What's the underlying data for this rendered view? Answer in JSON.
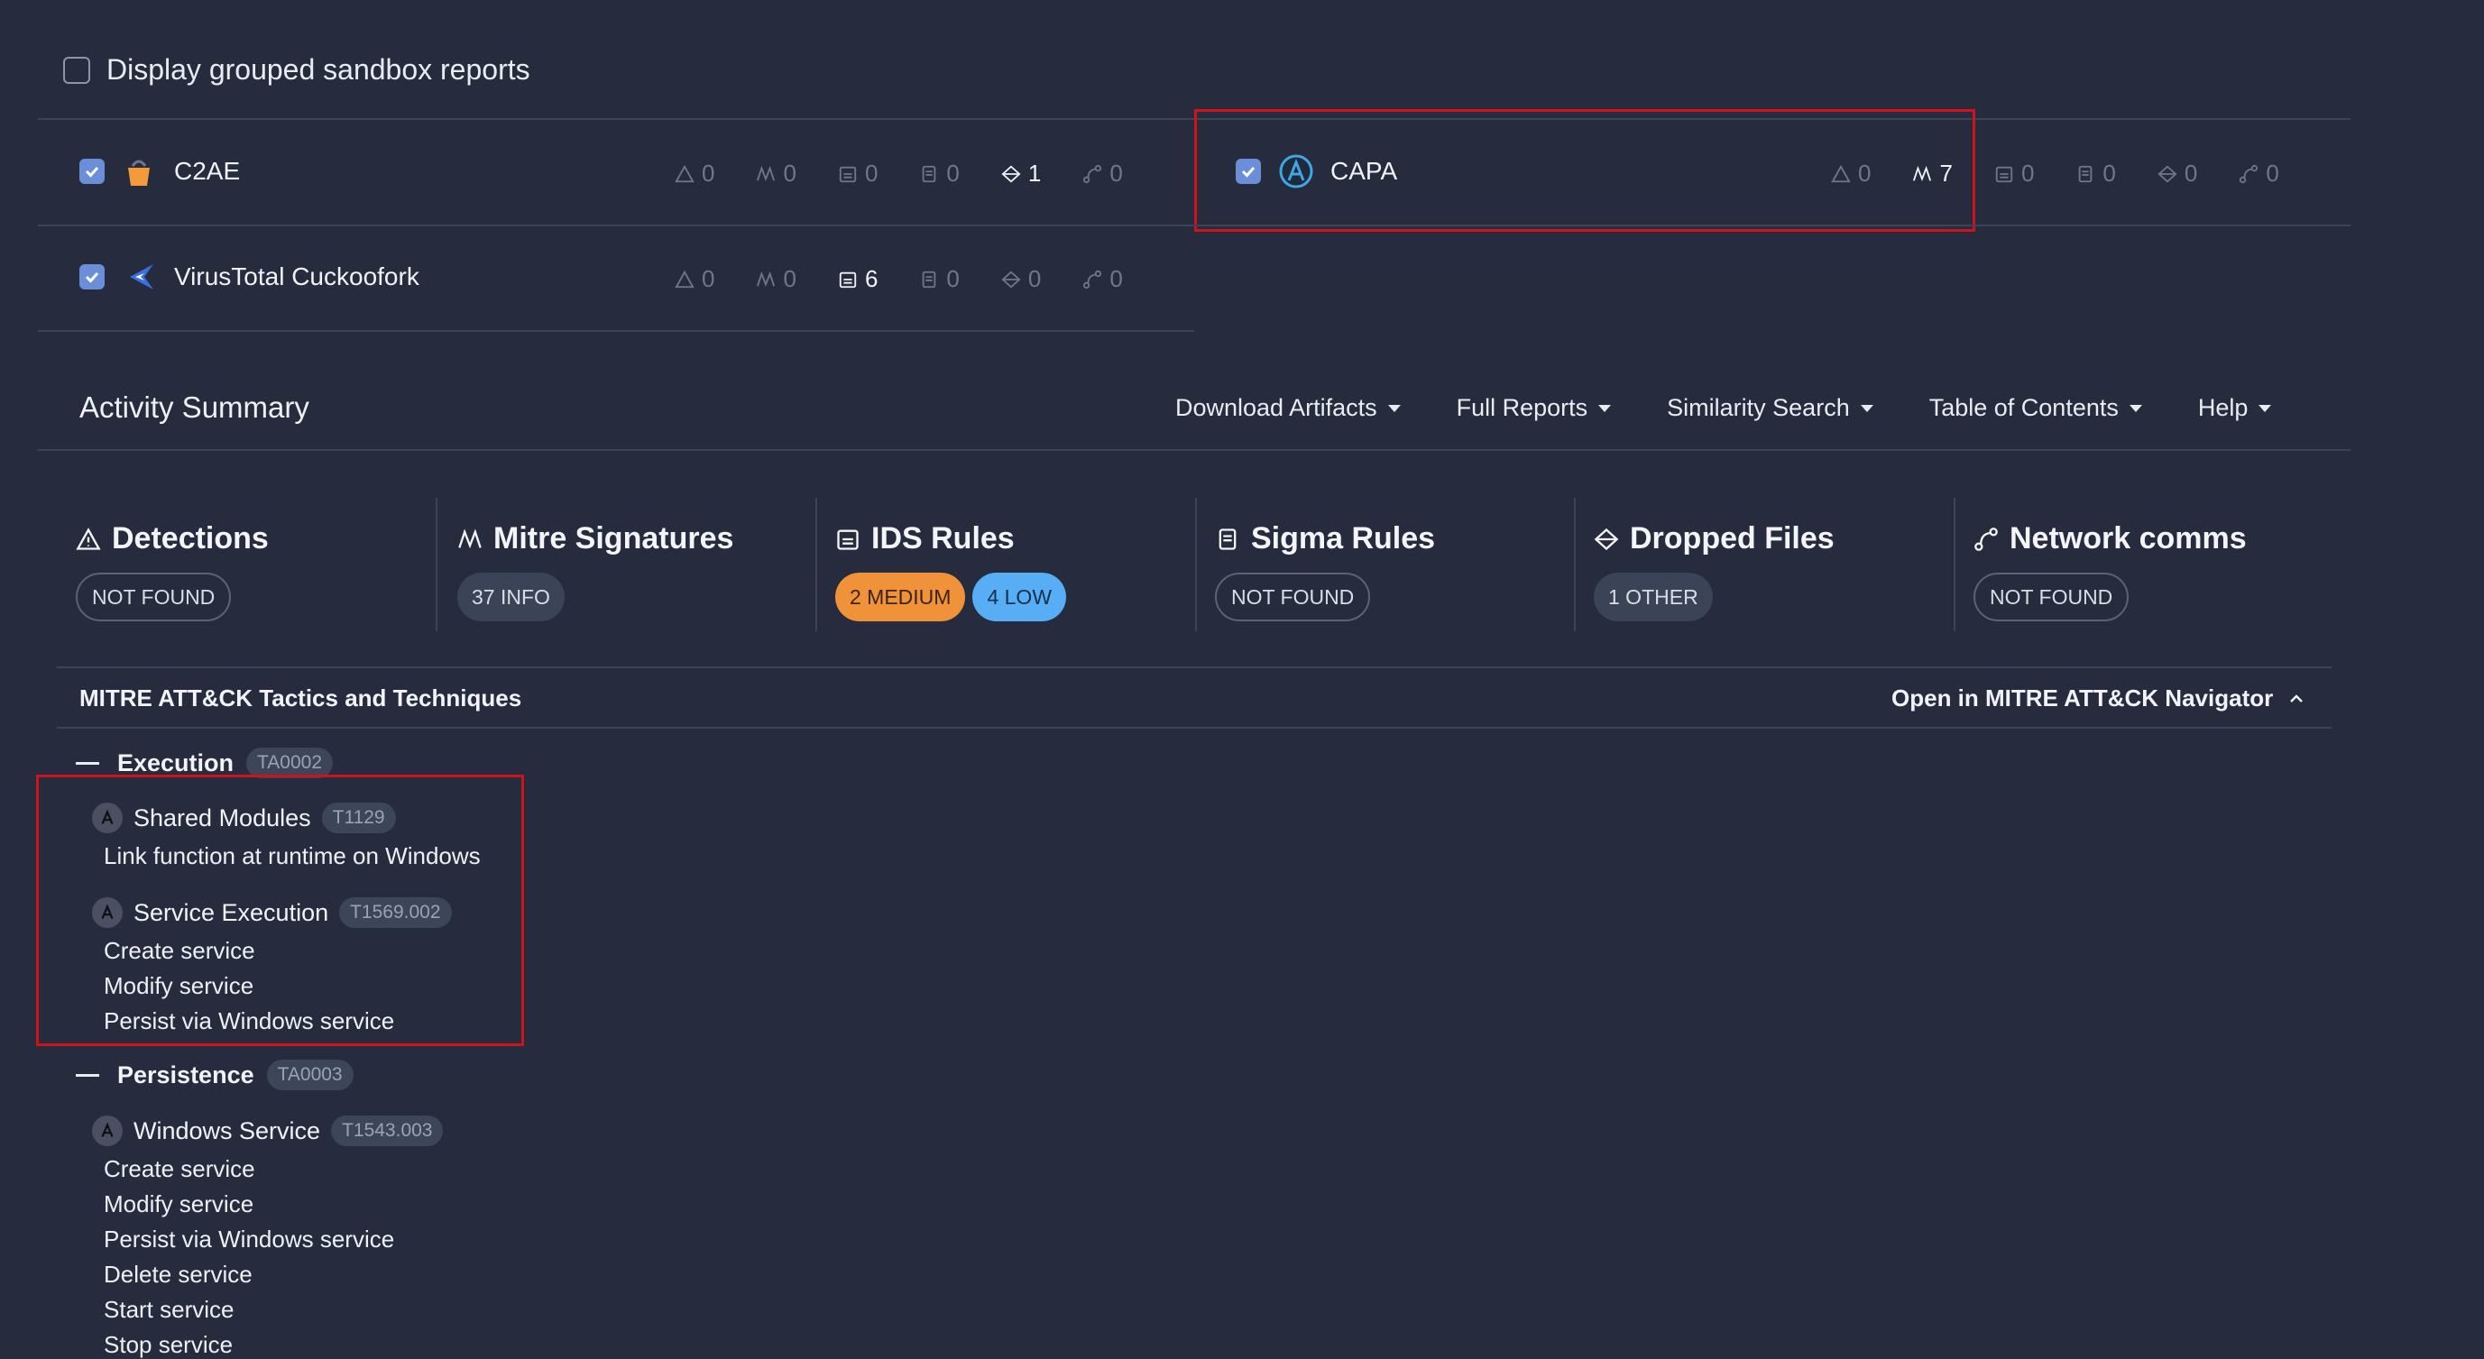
{
  "top": {
    "grouped_label": "Display grouped sandbox reports"
  },
  "sources": [
    {
      "name": "C2AE",
      "stats": {
        "detections": "0",
        "mitre": "0",
        "ids": "0",
        "sigma": "0",
        "dropped": "1",
        "network": "0"
      }
    },
    {
      "name": "CAPA",
      "stats": {
        "detections": "0",
        "mitre": "7",
        "ids": "0",
        "sigma": "0",
        "dropped": "0",
        "network": "0"
      }
    },
    {
      "name": "VirusTotal Cuckoofork",
      "stats": {
        "detections": "0",
        "mitre": "0",
        "ids": "6",
        "sigma": "0",
        "dropped": "0",
        "network": "0"
      }
    }
  ],
  "activity": {
    "title": "Activity Summary",
    "menus": [
      "Download Artifacts",
      "Full Reports",
      "Similarity Search",
      "Table of Contents",
      "Help"
    ]
  },
  "cards": [
    {
      "title": "Detections",
      "badges": [
        "NOT FOUND"
      ]
    },
    {
      "title": "Mitre Signatures",
      "badges": [
        "37 INFO"
      ]
    },
    {
      "title": "IDS Rules",
      "badges": [
        "2 MEDIUM",
        "4 LOW"
      ]
    },
    {
      "title": "Sigma Rules",
      "badges": [
        "NOT FOUND"
      ]
    },
    {
      "title": "Dropped Files",
      "badges": [
        "1 OTHER"
      ]
    },
    {
      "title": "Network comms",
      "badges": [
        "NOT FOUND"
      ]
    }
  ],
  "mitre": {
    "title": "MITRE ATT&CK Tactics and Techniques",
    "navigator": "Open in MITRE ATT&CK Navigator",
    "tactics": [
      {
        "name": "Execution",
        "id": "TA0002",
        "techniques": [
          {
            "name": "Shared Modules",
            "id": "T1129",
            "items": [
              "Link function at runtime on Windows"
            ]
          },
          {
            "name": "Service Execution",
            "id": "T1569.002",
            "items": [
              "Create service",
              "Modify service",
              "Persist via Windows service"
            ]
          }
        ]
      },
      {
        "name": "Persistence",
        "id": "TA0003",
        "techniques": [
          {
            "name": "Windows Service",
            "id": "T1543.003",
            "items": [
              "Create service",
              "Modify service",
              "Persist via Windows service",
              "Delete service",
              "Start service",
              "Stop service"
            ]
          }
        ]
      }
    ]
  },
  "colors": {
    "background": "#262c3d",
    "highlight": "#d0121b",
    "medium": "#f0923a",
    "low": "#58aef5",
    "checkbox": "#6a8fd8"
  }
}
